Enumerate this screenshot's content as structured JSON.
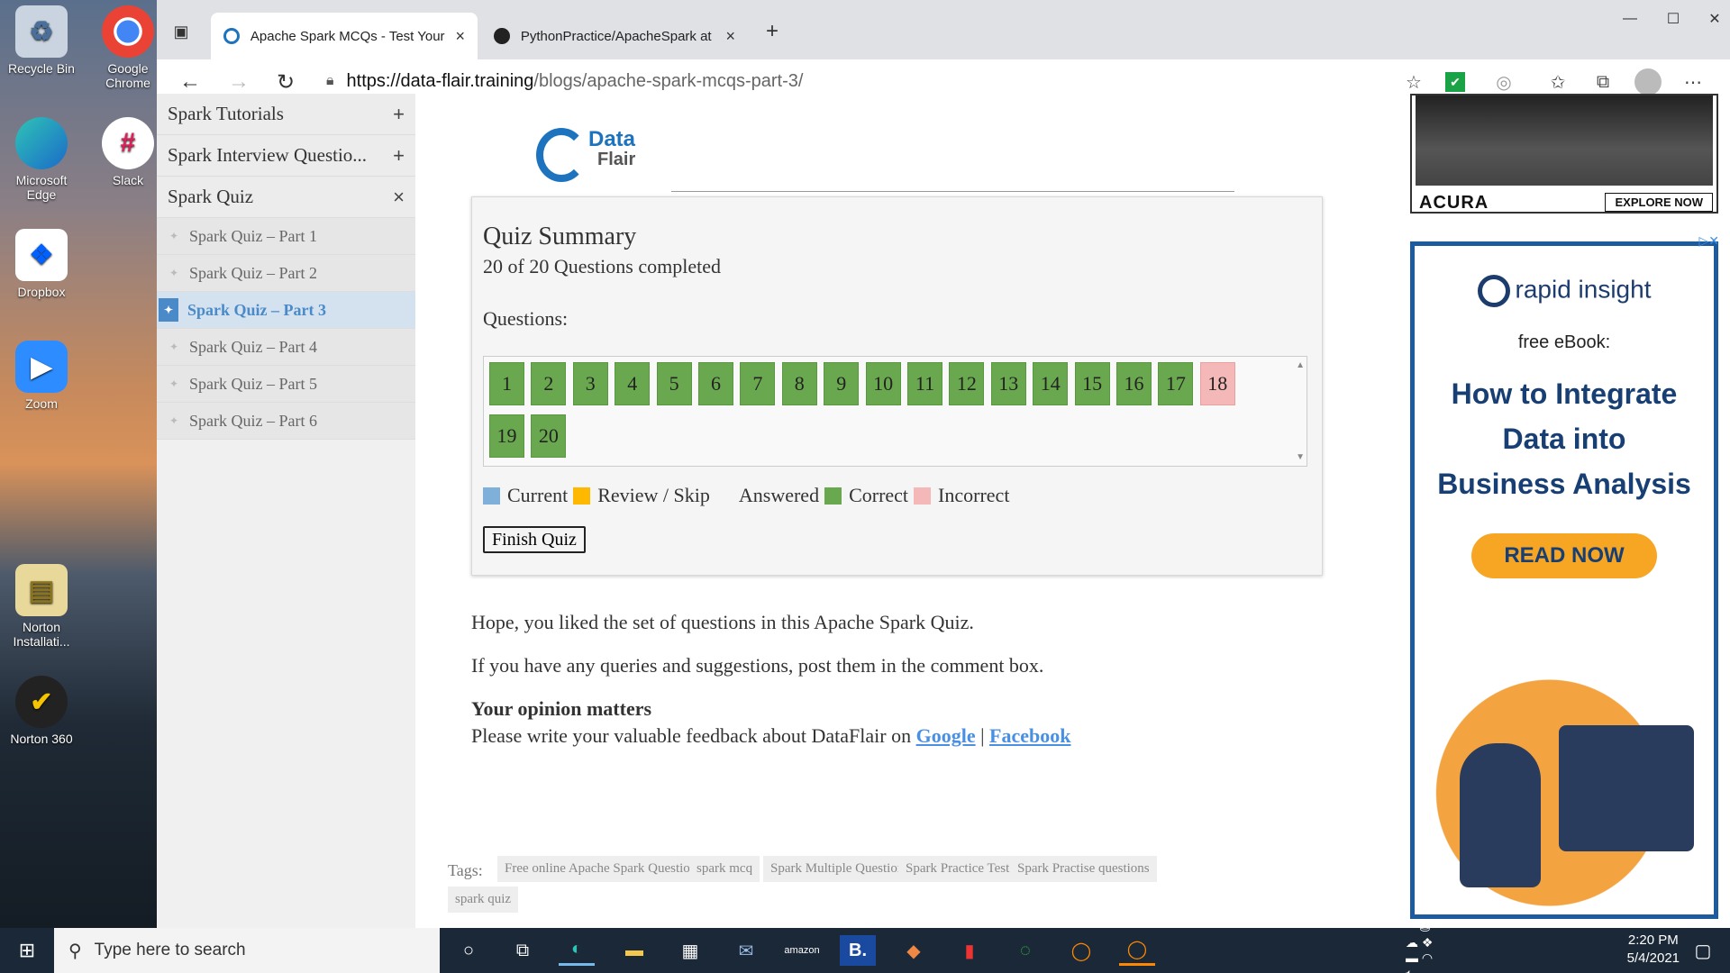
{
  "desktop": {
    "icons": [
      {
        "label": "Recycle Bin"
      },
      {
        "label": "Google Chrome"
      },
      {
        "label": "Microsoft Edge"
      },
      {
        "label": "Slack"
      },
      {
        "label": "Dropbox"
      },
      {
        "label": "Zoom"
      },
      {
        "label": "Norton Installati..."
      },
      {
        "label": "Norton 360"
      }
    ]
  },
  "browser": {
    "tabs": [
      {
        "title": "Apache Spark MCQs - Test Your",
        "close": "×"
      },
      {
        "title": "PythonPractice/ApacheSpark at",
        "close": "×"
      }
    ],
    "new_tab": "+",
    "window_controls": {
      "minimize": "—",
      "maximize": "☐",
      "close": "✕"
    },
    "url_host": "https://data-flair.training",
    "url_path": "/blogs/apache-spark-mcqs-part-3/"
  },
  "sidebar": {
    "sections": [
      {
        "label": "Spark Tutorials",
        "symbol": "+"
      },
      {
        "label": "Spark Interview Questio...",
        "symbol": "+"
      },
      {
        "label": "Spark Quiz",
        "symbol": "×"
      }
    ],
    "items": [
      {
        "label": "Spark Quiz – Part 1"
      },
      {
        "label": "Spark Quiz – Part 2"
      },
      {
        "label": "Spark Quiz – Part 3"
      },
      {
        "label": "Spark Quiz – Part 4"
      },
      {
        "label": "Spark Quiz – Part 5"
      },
      {
        "label": "Spark Quiz – Part 6"
      }
    ],
    "active_index": 2
  },
  "logo": {
    "line1": "Data",
    "line2": "Flair"
  },
  "quiz": {
    "title": "Quiz Summary",
    "completed_text": "20 of 20 Questions completed",
    "questions_label": "Questions:",
    "questions": [
      {
        "n": "1",
        "status": "correct"
      },
      {
        "n": "2",
        "status": "correct"
      },
      {
        "n": "3",
        "status": "correct"
      },
      {
        "n": "4",
        "status": "correct"
      },
      {
        "n": "5",
        "status": "correct"
      },
      {
        "n": "6",
        "status": "correct"
      },
      {
        "n": "7",
        "status": "correct"
      },
      {
        "n": "8",
        "status": "correct"
      },
      {
        "n": "9",
        "status": "correct"
      },
      {
        "n": "10",
        "status": "correct"
      },
      {
        "n": "11",
        "status": "correct"
      },
      {
        "n": "12",
        "status": "correct"
      },
      {
        "n": "13",
        "status": "correct"
      },
      {
        "n": "14",
        "status": "correct"
      },
      {
        "n": "15",
        "status": "correct"
      },
      {
        "n": "16",
        "status": "correct"
      },
      {
        "n": "17",
        "status": "correct"
      },
      {
        "n": "18",
        "status": "incorrect"
      },
      {
        "n": "19",
        "status": "correct"
      },
      {
        "n": "20",
        "status": "correct"
      }
    ],
    "legend": {
      "current": "Current",
      "review": "Review / Skip",
      "answered": "Answered",
      "correct": "Correct",
      "incorrect": "Incorrect"
    },
    "colors": {
      "current": "#7fb0d9",
      "review": "#ffb800",
      "correct": "#6aa84f",
      "incorrect": "#f4b8b8"
    },
    "finish_button": "Finish Quiz"
  },
  "body_text": {
    "p1": "Hope, you liked the set of questions in this Apache Spark Quiz.",
    "p2": "If you have any queries and suggestions, post them in the comment box.",
    "opinion_heading": "Your opinion matters",
    "feedback_prefix": "Please write your valuable feedback about DataFlair on",
    "link_google": "Google",
    "separator": "|",
    "link_facebook": "Facebook"
  },
  "tags": {
    "label": "Tags:",
    "items": [
      "Free online Apache Spark Questions",
      "spark mcq",
      "Spark Multiple Questions",
      "Spark Practice Test",
      "Spark Practise questions",
      "spark quiz"
    ]
  },
  "ads": {
    "acura_brand": "ACURA",
    "acura_cta": "EXPLORE NOW",
    "ri_logo": "rapid insight",
    "ri_free": "free eBook:",
    "ri_headline_1": "How to Integrate",
    "ri_headline_2": "Data into",
    "ri_headline_3": "Business Analysis",
    "ri_cta": "READ NOW"
  },
  "taskbar": {
    "search_placeholder": "Type here to search",
    "time": "2:20 PM",
    "date": "5/4/2021"
  }
}
